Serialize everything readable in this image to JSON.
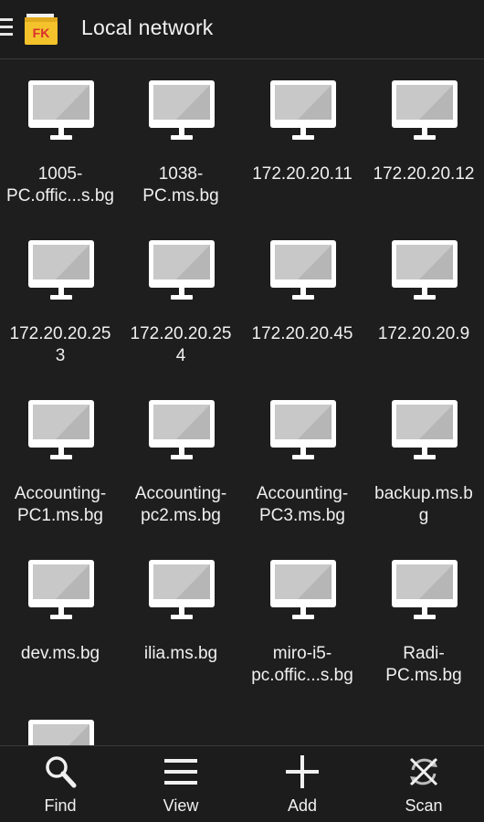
{
  "header": {
    "title": "Local network",
    "logo_text": "FK"
  },
  "hosts": [
    {
      "label": "1005-\nPC.offic...s.bg"
    },
    {
      "label": "1038-\nPC.ms.bg"
    },
    {
      "label": "172.20.20.11"
    },
    {
      "label": "172.20.20.12"
    },
    {
      "label": "172.20.20.25\n3"
    },
    {
      "label": "172.20.20.25\n4"
    },
    {
      "label": "172.20.20.45"
    },
    {
      "label": "172.20.20.9"
    },
    {
      "label": "Accounting-\nPC1.ms.bg"
    },
    {
      "label": "Accounting-\npc2.ms.bg"
    },
    {
      "label": "Accounting-\nPC3.ms.bg"
    },
    {
      "label": "backup.ms.b\ng"
    },
    {
      "label": "dev.ms.bg"
    },
    {
      "label": "ilia.ms.bg"
    },
    {
      "label": "miro-i5-\npc.offic...s.bg"
    },
    {
      "label": "Radi-\nPC.ms.bg"
    },
    {
      "label": ""
    }
  ],
  "toolbar": {
    "find_label": "Find",
    "view_label": "View",
    "add_label": "Add",
    "scan_label": "Scan"
  },
  "colors": {
    "background": "#1e1e1e",
    "monitor_frame": "#ffffff",
    "monitor_screen": "#c8c8c8",
    "logo_yellow": "#f4c22b",
    "logo_red": "#d9302c"
  },
  "icons": {
    "menu": "menu-icon",
    "host": "monitor-icon",
    "find": "search-icon",
    "view": "list-view-icon",
    "add": "plus-icon",
    "scan": "scan-icon"
  }
}
